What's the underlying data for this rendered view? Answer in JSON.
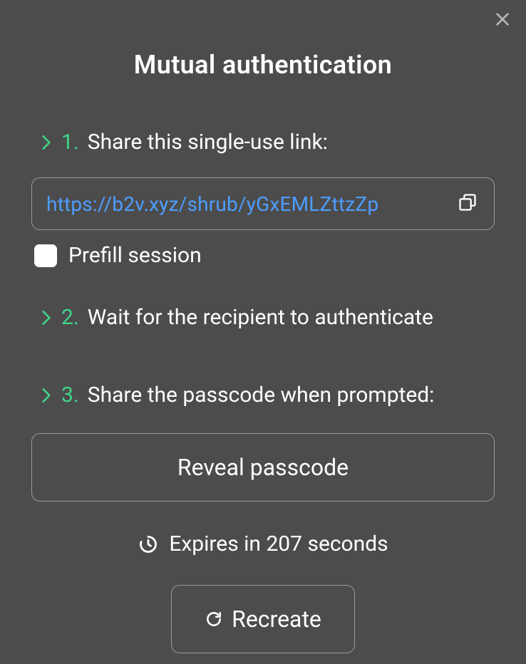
{
  "title": "Mutual authentication",
  "steps": {
    "one": {
      "num": "1.",
      "text": "Share this single-use link:"
    },
    "two": {
      "num": "2.",
      "text": "Wait for the recipient to authenticate"
    },
    "three": {
      "num": "3.",
      "text": "Share the passcode when prompted:"
    }
  },
  "link": "https://b2v.xyz/shrub/yGxEMLZttzZp",
  "prefill_label": "Prefill session",
  "reveal_label": "Reveal passcode",
  "expires_text": "Expires in 207 seconds",
  "recreate_label": "Recreate",
  "colors": {
    "background": "#4c4c4c",
    "accent_green": "#3fd58a",
    "link_blue": "#4d9dff",
    "border_gray": "#9a9a9a",
    "text_white": "#ffffff"
  }
}
